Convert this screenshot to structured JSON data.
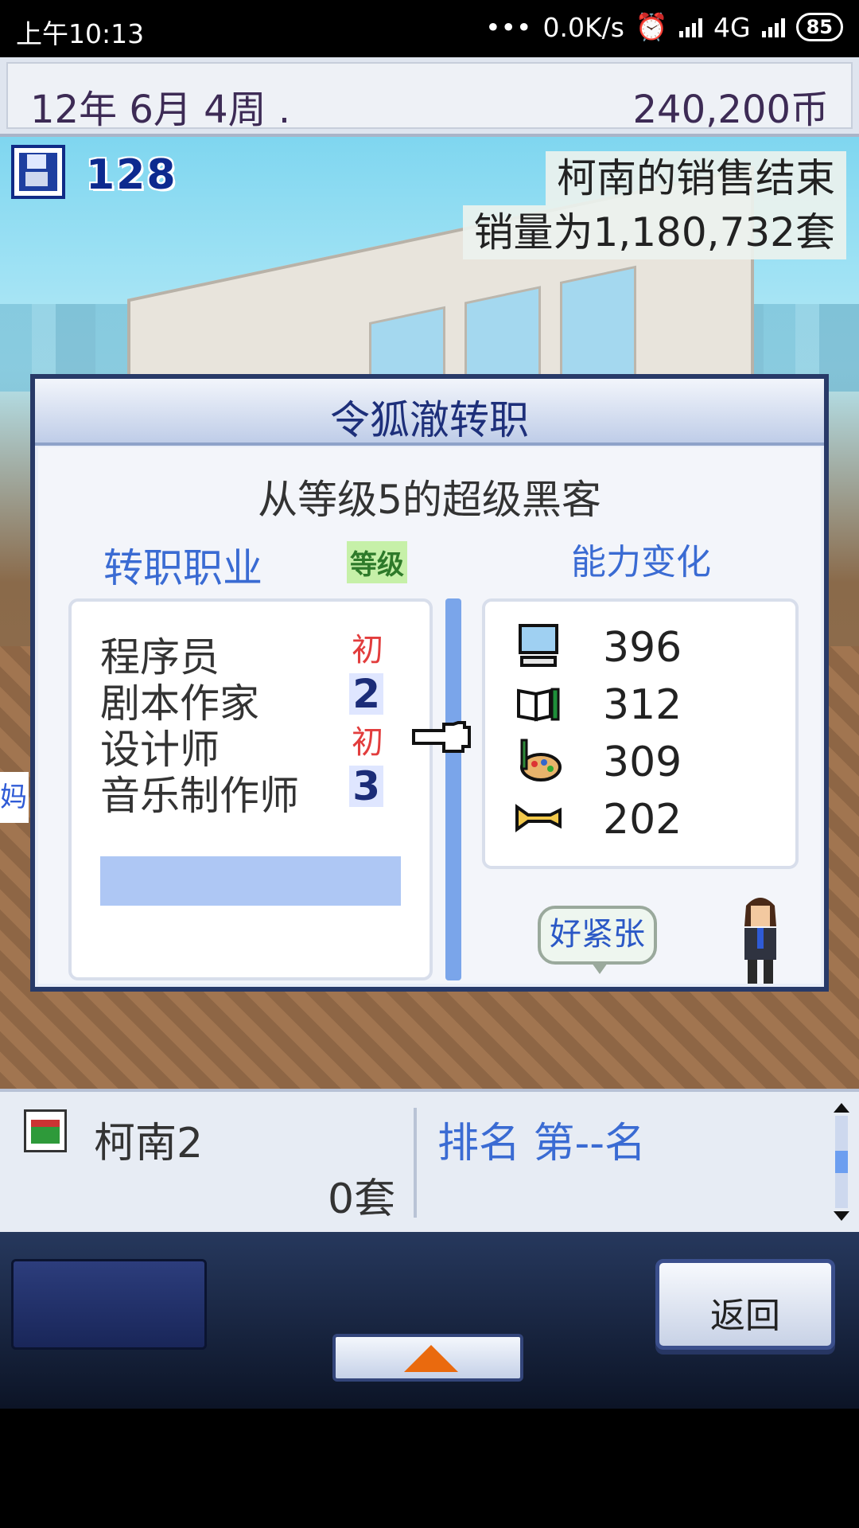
{
  "status_bar": {
    "time": "上午10:13",
    "dots": "•••",
    "speed": "0.0K/s",
    "network": "4G",
    "battery": "85"
  },
  "header": {
    "date": "12年 6月 4周 .",
    "money": "240,200币"
  },
  "scene": {
    "save_count": "128",
    "notice_line1": "柯南的销售结束",
    "notice_line2": "销量为1,180,732套",
    "side_chip": "妈"
  },
  "dialog": {
    "title": "令狐澈转职",
    "subtitle": "从等级5的超级黑客",
    "job_header": "转职职业",
    "level_header": "等级",
    "change_header": "能力变化",
    "jobs": [
      {
        "name": "程序员",
        "level": "初"
      },
      {
        "name": "剧本作家",
        "level": "2"
      },
      {
        "name": "设计师",
        "level": "初"
      },
      {
        "name": "音乐制作师",
        "level": "3"
      }
    ],
    "abilities": [
      {
        "icon": "computer-icon",
        "value": "396"
      },
      {
        "icon": "book-pencil-icon",
        "value": "312"
      },
      {
        "icon": "paint-palette-icon",
        "value": "309"
      },
      {
        "icon": "trumpet-icon",
        "value": "202"
      }
    ],
    "speech": "好紧张"
  },
  "info_panel": {
    "title": "柯南2",
    "units": "0套",
    "rank": "排名 第--名"
  },
  "controls": {
    "back_label": "返回"
  },
  "colors": {
    "accent_blue": "#3a6bd3",
    "dialog_border": "#283a68",
    "selection": "#aec7f4",
    "level_red": "#e23d3d"
  }
}
